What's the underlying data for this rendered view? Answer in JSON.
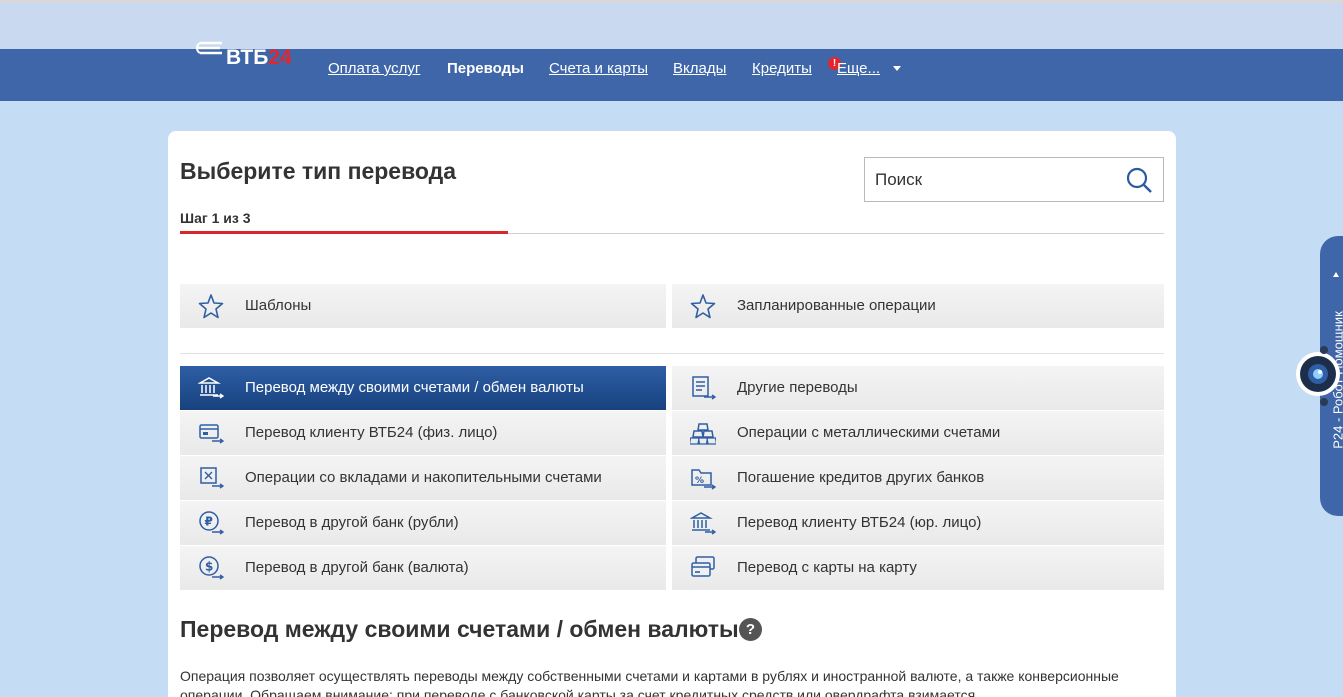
{
  "header": {
    "logo_text": "ВТБ",
    "logo_number": "24",
    "nav": [
      {
        "label": "Оплата услуг",
        "active": false
      },
      {
        "label": "Переводы",
        "active": true
      },
      {
        "label": "Счета и карты",
        "active": false
      },
      {
        "label": "Вклады",
        "active": false
      },
      {
        "label": "Кредиты",
        "active": false
      },
      {
        "label": "Еще...",
        "active": false
      }
    ],
    "alert_badge": "!"
  },
  "main": {
    "title": "Выберите тип перевода",
    "search": {
      "placeholder": "Поиск",
      "value": ""
    },
    "step": {
      "label": "Шаг 1 из 3",
      "current": 1,
      "total": 3
    },
    "quick_tiles": [
      {
        "label": "Шаблоны",
        "icon": "star-icon"
      },
      {
        "label": "Запланированные операции",
        "icon": "star-icon"
      }
    ],
    "transfer_types": [
      {
        "label": "Перевод между своими счетами / обмен валюты",
        "icon": "bank-transfer-icon",
        "active": true
      },
      {
        "label": "Другие переводы",
        "icon": "document-list-icon",
        "active": false
      },
      {
        "label": "Перевод клиенту ВТБ24 (физ. лицо)",
        "icon": "card-transfer-icon",
        "active": false
      },
      {
        "label": "Операции с металлическими счетами",
        "icon": "gold-bars-icon",
        "active": false
      },
      {
        "label": "Операции со вкладами и накопительными счетами",
        "icon": "deposit-icon",
        "active": false
      },
      {
        "label": "Погашение кредитов других банков",
        "icon": "percent-folder-icon",
        "active": false
      },
      {
        "label": "Перевод в другой банк (рубли)",
        "icon": "ruble-coin-icon",
        "active": false
      },
      {
        "label": "Перевод клиенту ВТБ24 (юр. лицо)",
        "icon": "bank-building-icon",
        "active": false
      },
      {
        "label": "Перевод в другой банк (валюта)",
        "icon": "dollar-coin-icon",
        "active": false
      },
      {
        "label": "Перевод с карты на карту",
        "icon": "card-to-card-icon",
        "active": false
      }
    ],
    "section_title": "Перевод между своими счетами / обмен валюты",
    "help_label": "?",
    "description": "Операция позволяет осуществлять переводы между собственными счетами и картами в рублях и иностранной валюте, а также конверсионные операции. Обращаем внимание: при переводе с банковской карты за счет кредитных средств или овердрафта взимается"
  },
  "assistant": {
    "label": "Р24 - Робот Помощник"
  },
  "colors": {
    "navbar": "#3e66a8",
    "accent_red": "#d9252b",
    "active_tile": "#1f4d8f",
    "page_bg": "#c5dcf5"
  }
}
